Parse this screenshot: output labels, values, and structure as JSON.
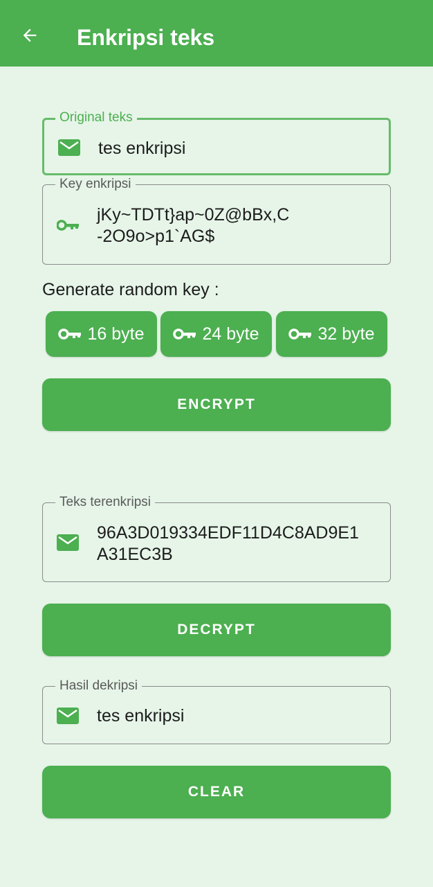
{
  "app_bar": {
    "title": "Enkripsi teks",
    "back_icon": "arrow-left-icon",
    "color": "#4caf50"
  },
  "original_text": {
    "label": "Original teks",
    "value": "tes enkripsi",
    "icon": "mail-icon"
  },
  "encryption_key": {
    "label": "Key enkripsi",
    "value": "jKy~TDTt}ap~0Z@bBx,C\n-2O9o>p1`AG$",
    "icon": "key-icon"
  },
  "random_key": {
    "label": "Generate random key :",
    "options": [
      {
        "label": "16 byte",
        "icon": "key-icon"
      },
      {
        "label": "24 byte",
        "icon": "key-icon"
      },
      {
        "label": "32 byte",
        "icon": "key-icon"
      }
    ]
  },
  "encrypt_button": {
    "label": "ENCRYPT"
  },
  "encrypted_text": {
    "label": "Teks terenkripsi",
    "value": "96A3D019334EDF11D4C8AD9E1\nA31EC3B",
    "icon": "mail-icon"
  },
  "decrypt_button": {
    "label": "DECRYPT"
  },
  "decrypted_result": {
    "label": "Hasil dekripsi",
    "value": "tes enkripsi",
    "icon": "mail-icon"
  },
  "clear_button": {
    "label": "CLEAR"
  },
  "colors": {
    "accent": "#4caf50",
    "background": "#e6f5e8",
    "focus_border": "#66bb6a"
  }
}
